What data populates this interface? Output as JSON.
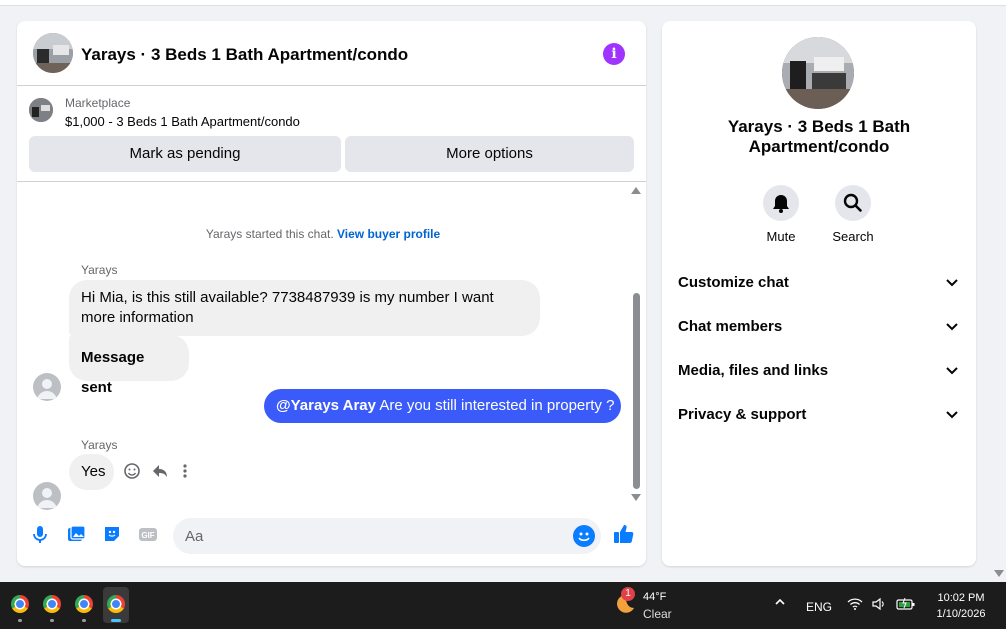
{
  "chat": {
    "title": "Yarays · 3 Beds 1 Bath Apartment/condo",
    "marketplace_label": "Marketplace",
    "listing_price_title": "$1,000 - 3 Beds 1 Bath Apartment/condo",
    "mark_pending_label": "Mark as pending",
    "more_options_label": "More options",
    "system_prefix": "Yarays started this chat.",
    "system_link": "View buyer profile",
    "messages": [
      {
        "sender": "Yarays",
        "text": "Hi Mia, is this still available? 7738487939 is my number I want more information"
      },
      {
        "text": "Message sent"
      },
      {
        "mention": "@Yarays Aray",
        "text": " Are you still interested in property ?"
      },
      {
        "sender": "Yarays",
        "text": "Yes"
      }
    ],
    "composer_placeholder": "Aa",
    "accent_color": "#3b5afa",
    "info_color": "#a033ff"
  },
  "details": {
    "title": "Yarays · 3 Beds 1 Bath Apartment/condo",
    "mute_label": "Mute",
    "search_label": "Search",
    "sections": [
      "Customize chat",
      "Chat members",
      "Media, files and links",
      "Privacy & support"
    ]
  },
  "taskbar": {
    "apps": [
      "chrome-icon",
      "chrome-icon",
      "chrome-icon",
      "chrome-icon"
    ],
    "weather_temp": "44°F",
    "weather_cond": "Clear",
    "weather_badge": "1",
    "language": "ENG",
    "time": "10:02 PM",
    "date": "1/10/2026"
  }
}
